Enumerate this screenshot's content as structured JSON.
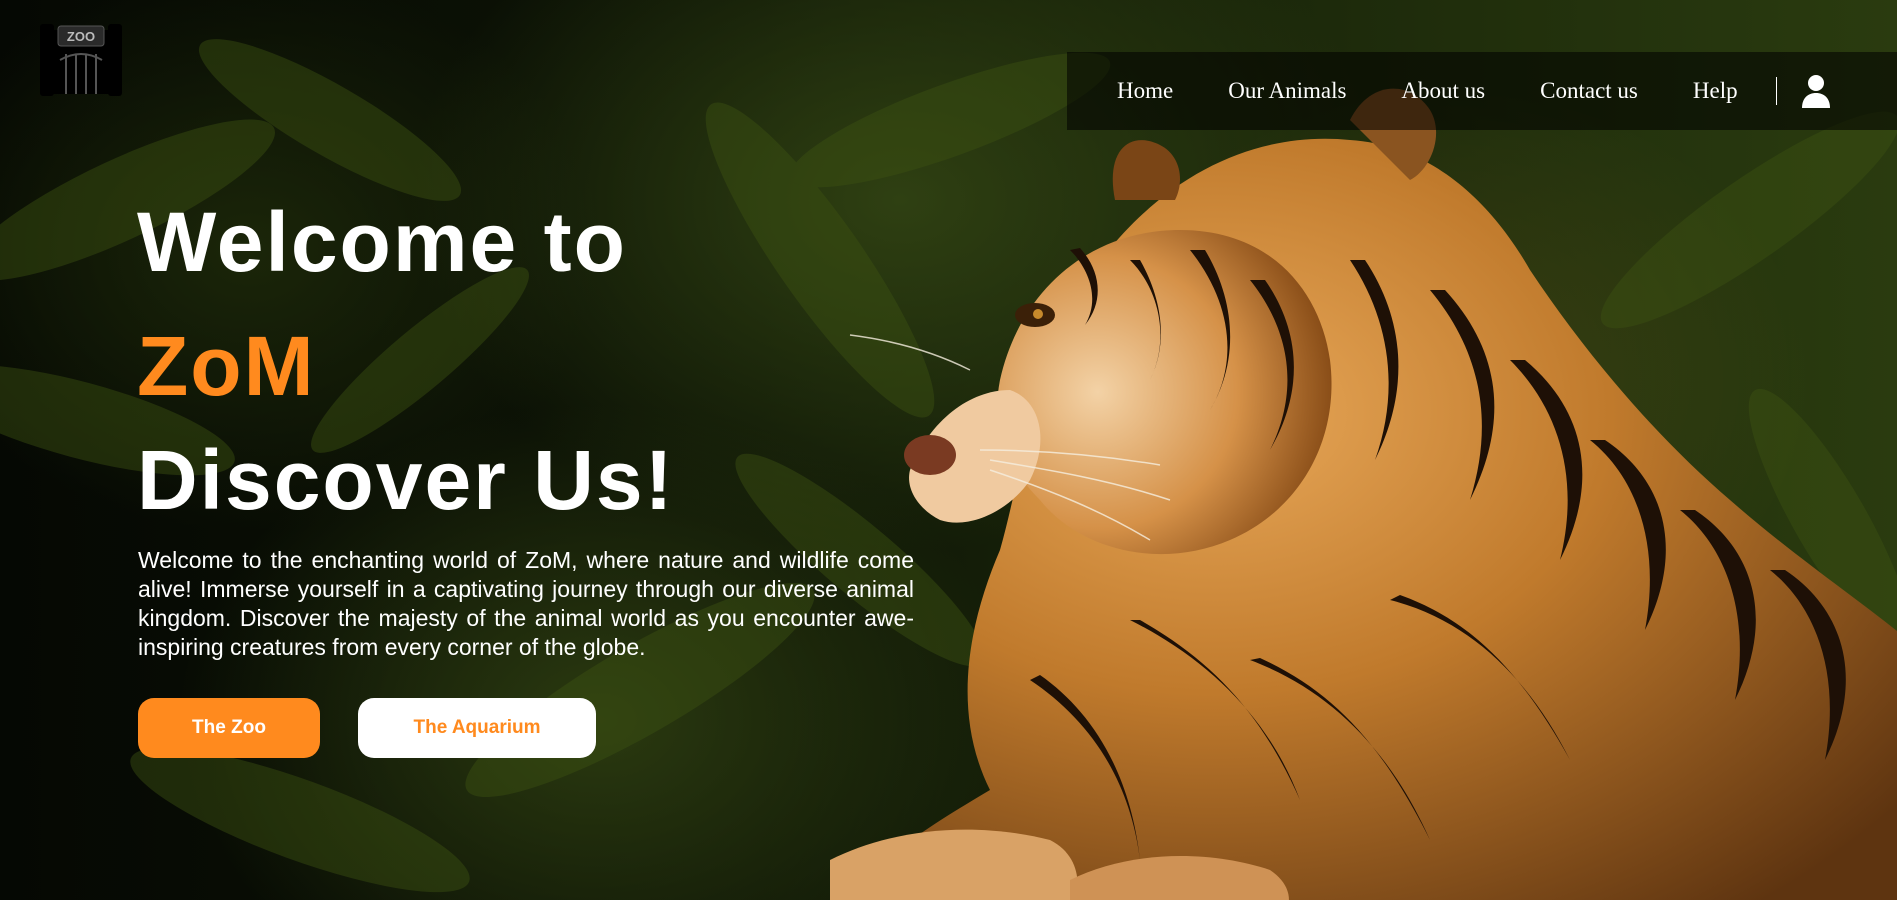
{
  "brand": {
    "logo_text": "ZOO",
    "logo_icon": "zoo-gate-icon"
  },
  "nav": {
    "items": [
      {
        "label": "Home"
      },
      {
        "label": "Our Animals"
      },
      {
        "label": "About us"
      },
      {
        "label": "Contact us"
      },
      {
        "label": "Help"
      }
    ],
    "account_icon": "user-icon"
  },
  "hero": {
    "line1": "Welcome to",
    "line2": "ZoM",
    "line3": "Discover Us!",
    "intro": "Welcome to the enchanting world of ZoM, where nature and wildlife come alive! Immerse yourself in a captivating journey through our diverse animal kingdom. Discover the majesty of the animal world as you encounter awe-inspiring creatures from every corner of the globe.",
    "primary_button": "The Zoo",
    "secondary_button": "The Aquarium"
  },
  "colors": {
    "accent": "#ff8a1e",
    "text": "#ffffff",
    "nav_background": "rgba(0,0,0,0.55)"
  }
}
